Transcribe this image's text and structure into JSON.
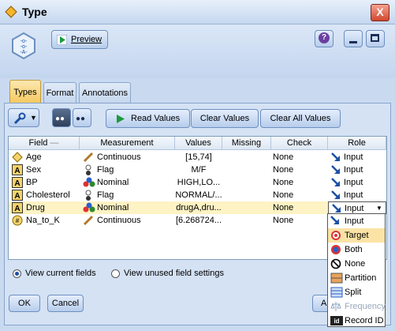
{
  "window": {
    "title": "Type",
    "close_glyph": "X"
  },
  "toolbar": {
    "preview_label": "Preview",
    "help_glyph": "?"
  },
  "tabs": [
    {
      "label": "Types"
    },
    {
      "label": "Format"
    },
    {
      "label": "Annotations"
    }
  ],
  "actions": {
    "read_values": "Read Values",
    "clear_values": "Clear Values",
    "clear_all_values": "Clear All Values"
  },
  "table": {
    "columns": [
      "Field",
      "Measurement",
      "Values",
      "Missing",
      "Check",
      "Role"
    ],
    "rows": [
      {
        "field": "Age",
        "field_icon": "continuous-field-icon",
        "measurement": "Continuous",
        "meas_icon": "ruler-icon",
        "values": "[15,74]",
        "missing": "",
        "check": "None",
        "role": "Input"
      },
      {
        "field": "Sex",
        "field_icon": "string-field-icon",
        "measurement": "Flag",
        "meas_icon": "flag-icon",
        "values": "M/F",
        "missing": "",
        "check": "None",
        "role": "Input"
      },
      {
        "field": "BP",
        "field_icon": "string-field-icon",
        "measurement": "Nominal",
        "meas_icon": "nominal-icon",
        "values": "HIGH,LO...",
        "missing": "",
        "check": "None",
        "role": "Input"
      },
      {
        "field": "Cholesterol",
        "field_icon": "string-field-icon",
        "measurement": "Flag",
        "meas_icon": "flag-icon",
        "values": "NORMAL/...",
        "missing": "",
        "check": "None",
        "role": "Input"
      },
      {
        "field": "Drug",
        "field_icon": "string-field-icon",
        "measurement": "Nominal",
        "meas_icon": "nominal-icon",
        "values": "drugA,dru...",
        "missing": "",
        "check": "None",
        "role": "Input"
      },
      {
        "field": "Na_to_K",
        "field_icon": "real-field-icon",
        "measurement": "Continuous",
        "meas_icon": "ruler-icon",
        "values": "[6.268724...",
        "missing": "",
        "check": "None",
        "role": ""
      }
    ]
  },
  "view": {
    "current_label": "View current fields",
    "unused_label": "View unused field settings",
    "selected": "current"
  },
  "role_dropdown": {
    "options": [
      {
        "label": "Input",
        "icon": "input-arrow-icon",
        "highlighted": false
      },
      {
        "label": "Target",
        "icon": "target-icon",
        "highlighted": true
      },
      {
        "label": "Both",
        "icon": "both-icon",
        "highlighted": false
      },
      {
        "label": "None",
        "icon": "none-icon",
        "highlighted": false
      },
      {
        "label": "Partition",
        "icon": "partition-icon",
        "highlighted": false
      },
      {
        "label": "Split",
        "icon": "split-icon",
        "highlighted": false
      },
      {
        "label": "Frequency",
        "icon": "frequency-icon",
        "highlighted": false
      },
      {
        "label": "Record ID",
        "icon": "record-id-icon",
        "highlighted": false
      }
    ]
  },
  "footer": {
    "ok_label": "OK",
    "cancel_label": "Cancel",
    "apply_label": "Ap"
  }
}
